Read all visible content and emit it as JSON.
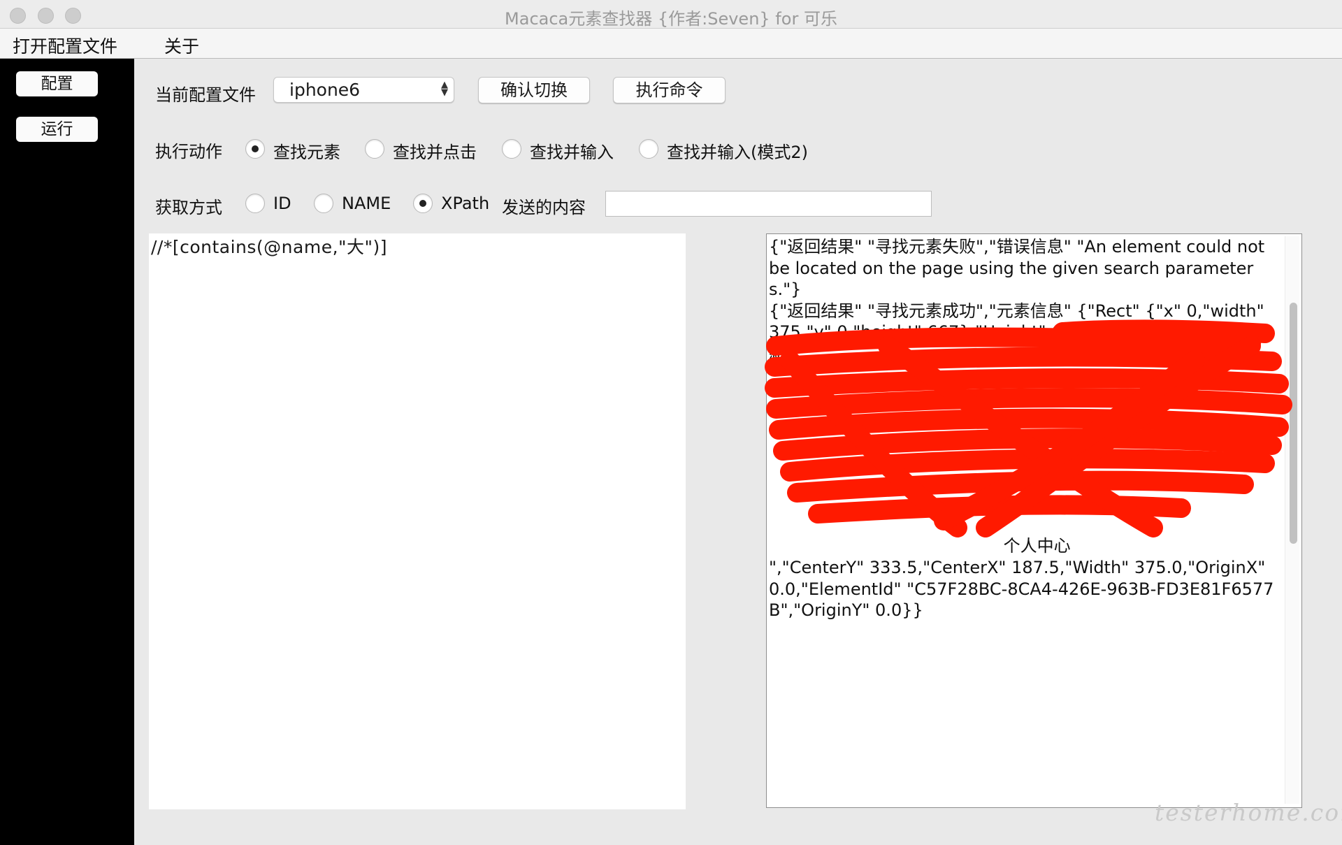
{
  "window": {
    "title": "Macaca元素查找器 {作者:Seven} for 可乐"
  },
  "menu": {
    "items": [
      "打开配置文件",
      "关于"
    ]
  },
  "sidebar": {
    "config_label": "配置",
    "run_label": "运行"
  },
  "config_row": {
    "label": "当前配置文件",
    "selected": "iphone6",
    "confirm_label": "确认切换",
    "exec_label": "执行命令"
  },
  "action_row": {
    "label": "执行动作",
    "options": [
      {
        "label": "查找元素",
        "checked": true
      },
      {
        "label": "查找并点击",
        "checked": false
      },
      {
        "label": "查找并输入",
        "checked": false
      },
      {
        "label": "查找并输入(模式2)",
        "checked": false
      }
    ]
  },
  "method_row": {
    "label": "获取方式",
    "options": [
      {
        "label": "ID",
        "checked": false
      },
      {
        "label": "NAME",
        "checked": false
      },
      {
        "label": "XPath",
        "checked": true
      }
    ],
    "send_label": "发送的内容",
    "send_value": ""
  },
  "xpath_input": "//*[contains(@name,\"大\")]",
  "result": {
    "text": "{\"返回结果\" \"寻找元素失败\",\"错误信息\" \"An element could not be located on the page using the given search parameters.\"}\n{\"返回结果\" \"寻找元素成功\",\"元素信息\" {\"Rect\" {\"x\" 0,\"width\" 375,\"y\" 0,\"height\" 667},\"Height\" 667.0,\"text\" \"  下拉即可刷新...\n\n\n\n\n\n\n\n\n                                            个人中心\n\",\"CenterY\" 333.5,\"CenterX\" 187.5,\"Width\" 375.0,\"OriginX\" 0.0,\"ElementId\" \"C57F28BC-8CA4-426E-963B-FD3E81F6577B\",\"OriginY\" 0.0}}",
    "redaction_color": "#ff1a00"
  },
  "watermark": "testerhome.com"
}
